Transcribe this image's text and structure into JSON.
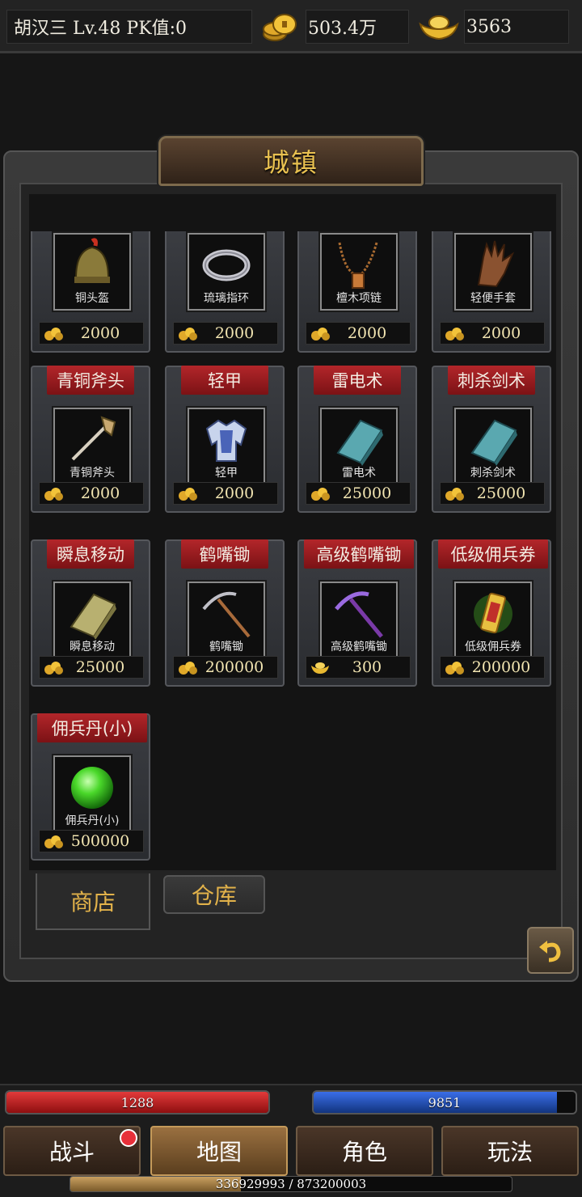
{
  "header": {
    "player": "胡汉三  Lv.48 PK值:0",
    "gold": "503.4万",
    "ingot": "3563"
  },
  "panel": {
    "title": "城镇"
  },
  "items": [
    {
      "name": "",
      "label": "铜头盔",
      "price": "2000",
      "currency": "gold",
      "icon": "helmet-icon"
    },
    {
      "name": "",
      "label": "琉璃指环",
      "price": "2000",
      "currency": "gold",
      "icon": "ring-icon"
    },
    {
      "name": "",
      "label": "檀木项链",
      "price": "2000",
      "currency": "gold",
      "icon": "necklace-icon"
    },
    {
      "name": "",
      "label": "轻便手套",
      "price": "2000",
      "currency": "gold",
      "icon": "glove-icon"
    },
    {
      "name": "青铜斧头",
      "label": "青铜斧头",
      "price": "2000",
      "currency": "gold",
      "icon": "axe-icon"
    },
    {
      "name": "轻甲",
      "label": "轻甲",
      "price": "2000",
      "currency": "gold",
      "icon": "armor-icon"
    },
    {
      "name": "雷电术",
      "label": "雷电术",
      "price": "25000",
      "currency": "gold",
      "icon": "skill-book-icon"
    },
    {
      "name": "刺杀剑术",
      "label": "刺杀剑术",
      "price": "25000",
      "currency": "gold",
      "icon": "skill-book-icon"
    },
    {
      "name": "瞬息移动",
      "label": "瞬息移动",
      "price": "25000",
      "currency": "gold",
      "icon": "scroll-book-icon"
    },
    {
      "name": "鹤嘴锄",
      "label": "鹤嘴锄",
      "price": "200000",
      "currency": "gold",
      "icon": "pickaxe-icon"
    },
    {
      "name": "高级鹤嘴锄",
      "label": "高级鹤嘴锄",
      "price": "300",
      "currency": "ingot",
      "icon": "purple-pickaxe-icon"
    },
    {
      "name": "低级佣兵券",
      "label": "低级佣兵券",
      "price": "200000",
      "currency": "gold",
      "icon": "voucher-icon"
    },
    {
      "name": "佣兵丹(小)",
      "label": "佣兵丹(小)",
      "price": "500000",
      "currency": "gold",
      "icon": "green-orb-icon"
    }
  ],
  "tabs": {
    "shop": "商店",
    "warehouse": "仓库"
  },
  "hud": {
    "hp": "1288",
    "hp_fill": 1.0,
    "mp": "9851",
    "mp_fill": 0.93,
    "exp": "336929993 / 873200003",
    "exp_fill": 0.386
  },
  "nav": {
    "battle": "战斗",
    "map": "地图",
    "character": "角色",
    "gameplay": "玩法"
  },
  "colors": {
    "accent_gold": "#e9c150",
    "ribbon_red": "#b3262a",
    "hp_red": "#e23a3a",
    "mp_blue": "#3a6ee8"
  }
}
